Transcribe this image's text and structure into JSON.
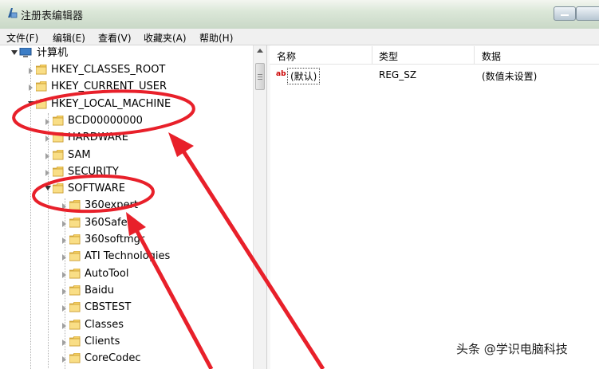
{
  "window": {
    "title": "注册表编辑器",
    "icon": "regedit-icon"
  },
  "menu": [
    "文件(F)",
    "编辑(E)",
    "查看(V)",
    "收藏夹(A)",
    "帮助(H)"
  ],
  "tree": {
    "root": "计算机",
    "nodes": [
      {
        "label": "HKEY_CLASSES_ROOT",
        "expanded": false
      },
      {
        "label": "HKEY_CURRENT_USER",
        "expanded": false
      },
      {
        "label": "HKEY_LOCAL_MACHINE",
        "expanded": true
      },
      {
        "label": "BCD00000000",
        "expanded": false
      },
      {
        "label": "HARDWARE",
        "expanded": false
      },
      {
        "label": "SAM",
        "expanded": false
      },
      {
        "label": "SECURITY",
        "expanded": false
      },
      {
        "label": "SOFTWARE",
        "expanded": true
      },
      {
        "label": "360expert",
        "expanded": false
      },
      {
        "label": "360Safe",
        "expanded": false
      },
      {
        "label": "360softmgr",
        "expanded": false
      },
      {
        "label": "ATI Technologies",
        "expanded": false
      },
      {
        "label": "AutoTool",
        "expanded": false
      },
      {
        "label": "Baidu",
        "expanded": false
      },
      {
        "label": "CBSTEST",
        "expanded": false
      },
      {
        "label": "Classes",
        "expanded": false
      },
      {
        "label": "Clients",
        "expanded": false
      },
      {
        "label": "CoreCodec",
        "expanded": false
      }
    ]
  },
  "list": {
    "columns": [
      "名称",
      "类型",
      "数据"
    ],
    "rows": [
      {
        "name": "(默认)",
        "type": "REG_SZ",
        "data": "(数值未设置)"
      }
    ]
  },
  "annotation_color": "#e8202a",
  "watermark": "头条 @学识电脑科技"
}
